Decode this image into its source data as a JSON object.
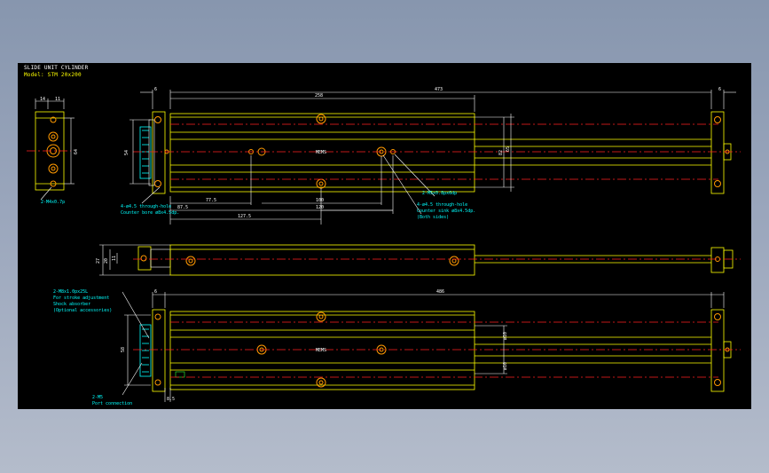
{
  "title_block": {
    "line1": "SLIDE UNIT CYLINDER",
    "line2": "Model: STM 20x200"
  },
  "dimensions": {
    "top_total": "473",
    "top_body": "258",
    "left_end": "6",
    "right_end": "6",
    "side_w1": "14",
    "side_w2": "11",
    "side_h": "64",
    "front_h": "54",
    "inner_h1": "82",
    "inner_h2": "65",
    "x1": "77.5",
    "x2": "87.5",
    "x3": "127.5",
    "x4": "100",
    "x5": "120",
    "mid_h1": "27",
    "mid_h2": "20",
    "mid_h3": "11",
    "bottom_total": "486",
    "bottom_end": "6",
    "bot_h": "58",
    "bot_d1": "ø10",
    "bot_d2": "ø10",
    "bot_small": "8.5"
  },
  "notes": {
    "n_m4": "2-M4x0.7p",
    "n_m5": "2-M5x0.8px6dp",
    "n_holes1a": "4-ø4.5 through-hole",
    "n_holes1b": "Counter bore ø8x4.5dp.",
    "n_holes2a": "4-ø4.5 through-hole",
    "n_holes2b": "Counter sink ø8x4.5dp.",
    "n_holes2c": "(Both sides)",
    "n_stroke1": "2-M8x1.0px25L",
    "n_stroke2": "For stroke adjustment",
    "n_stroke3": "Shock absorber",
    "n_stroke4": "(Optional accessories)",
    "n_port1": "2-M5",
    "n_port2": "Port connection",
    "label_top": "MEMS",
    "label_bot": "MEMS"
  }
}
